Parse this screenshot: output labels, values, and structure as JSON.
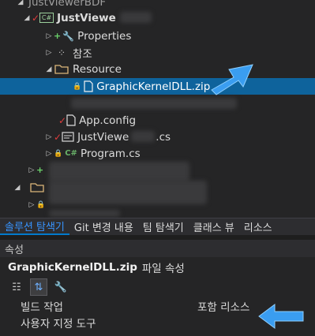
{
  "tree": {
    "root_label": "JustViewerBDF",
    "project_label": "JustViewe",
    "items": [
      {
        "label": "Properties",
        "icon": "wrench-icon"
      },
      {
        "label": "참조",
        "icon": "references-icon"
      },
      {
        "label": "Resource",
        "icon": "folder-icon"
      },
      {
        "label": "GraphicKernelDLL.zip",
        "icon": "file-icon"
      },
      {
        "label": "App.config",
        "icon": "config-file-icon"
      },
      {
        "label": "JustViewe",
        "suffix": ".cs",
        "icon": "form-icon"
      },
      {
        "label": "Program.cs",
        "icon": "csharp-file-icon"
      }
    ]
  },
  "tabs": [
    "솔루션 탐색기",
    "Git 변경 내용",
    "팀 탐색기",
    "클래스 뷰",
    "리소스"
  ],
  "properties": {
    "title": "속성",
    "object_name": "GraphicKernelDLL.zip",
    "object_type": "파일 속성",
    "rows": [
      {
        "name": "빌드 작업",
        "value": "포함 리소스"
      },
      {
        "name": "사용자 지정 도구",
        "value": ""
      }
    ]
  },
  "colors": {
    "accent": "#0e639c",
    "callout": "#3a9df0"
  }
}
